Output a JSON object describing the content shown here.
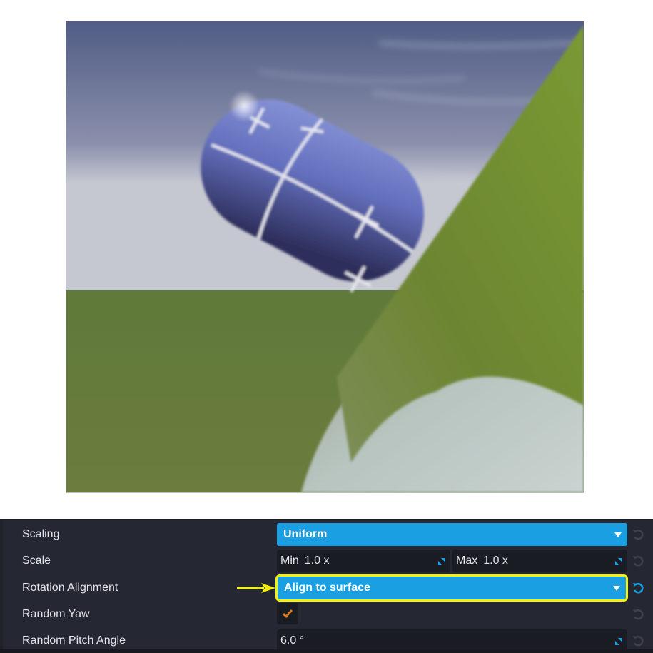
{
  "viewport": {
    "scene_description": "3D preview: blue capsule with white grid marks aligned to a green grassy slope, sky background",
    "colors": {
      "sky_top": "#56628a",
      "sky_bottom": "#c4c6d0",
      "ground": "#657a3c",
      "slope": "#6f8a35",
      "capsule": "#6b78c4",
      "rock": "#a9b6ae"
    }
  },
  "panel": {
    "rows": [
      {
        "label": "Scaling",
        "control": "dropdown",
        "value": "Uniform",
        "reset_active": false
      },
      {
        "label": "Scale",
        "control": "range",
        "min_label": "Min",
        "min_value": "1.0 x",
        "max_label": "Max",
        "max_value": "1.0 x",
        "reset_active": false
      },
      {
        "label": "Rotation Alignment",
        "control": "dropdown",
        "value": "Align to surface",
        "highlighted": true,
        "reset_active": true
      },
      {
        "label": "Random Yaw",
        "control": "checkbox",
        "checked": true,
        "reset_active": false
      },
      {
        "label": "Random Pitch Angle",
        "control": "number",
        "value": "6.0 °",
        "reset_active": false
      }
    ],
    "colors": {
      "accent": "#1a9fe3",
      "highlight": "#f5f10a",
      "check": "#d97a1b",
      "reset_inactive": "#3e424d",
      "reset_active": "#1a9fe3"
    }
  },
  "annotation": {
    "type": "arrow",
    "color": "#f5f10a",
    "points_to": "Rotation Alignment dropdown"
  }
}
